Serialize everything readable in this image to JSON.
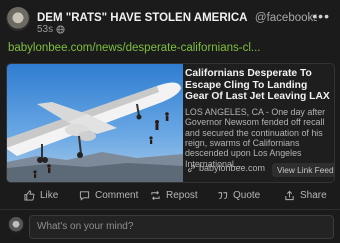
{
  "post": {
    "author_name": "DEM \"RATS\" HAVE STOLEN AMERICA",
    "author_handle": "@facebooksucksass",
    "timestamp": "53s",
    "more_icon": "more-horizontal-icon",
    "link_text": "babylonbee.com/news/desperate-californians-cl..."
  },
  "card": {
    "title": "Californians Desperate To Escape Cling To Landing Gear Of Last Jet Leaving LAX",
    "description": "LOS ANGELES, CA - One day after Governor Newsom fended off recall and secured the continuation of his reign, swarms of Californians descended upon Los Angeles International...",
    "domain": "babylonbee.com",
    "view_feed_label": "View Link Feed"
  },
  "actions": {
    "like": "Like",
    "comment": "Comment",
    "repost": "Repost",
    "quote": "Quote",
    "share": "Share"
  },
  "composer": {
    "placeholder": "What's on your mind?"
  },
  "colors": {
    "link": "#7fbf3f",
    "background": "#1b1b1b",
    "text": "#e4e6eb",
    "muted": "#9a9a9a"
  }
}
